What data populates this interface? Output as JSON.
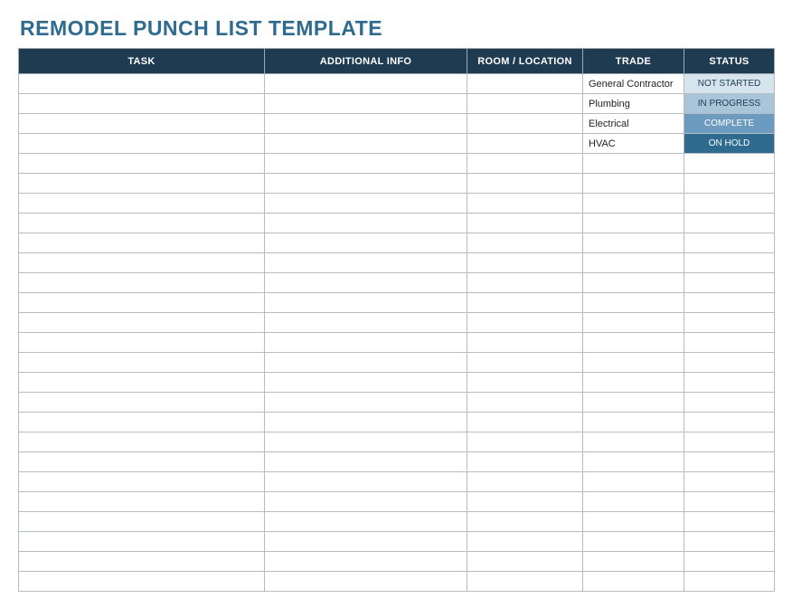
{
  "title": "REMODEL PUNCH LIST TEMPLATE",
  "columns": {
    "task": "TASK",
    "info": "ADDITIONAL INFO",
    "room": "ROOM / LOCATION",
    "trade": "TRADE",
    "status": "STATUS"
  },
  "rows": [
    {
      "task": "",
      "info": "",
      "room": "",
      "trade": "General Contractor",
      "status": "NOT STARTED",
      "status_class": "st-not-started"
    },
    {
      "task": "",
      "info": "",
      "room": "",
      "trade": "Plumbing",
      "status": "IN PROGRESS",
      "status_class": "st-in-progress"
    },
    {
      "task": "",
      "info": "",
      "room": "",
      "trade": "Electrical",
      "status": "COMPLETE",
      "status_class": "st-complete"
    },
    {
      "task": "",
      "info": "",
      "room": "",
      "trade": "HVAC",
      "status": "ON HOLD",
      "status_class": "st-on-hold"
    },
    {
      "task": "",
      "info": "",
      "room": "",
      "trade": "",
      "status": "",
      "status_class": ""
    },
    {
      "task": "",
      "info": "",
      "room": "",
      "trade": "",
      "status": "",
      "status_class": ""
    },
    {
      "task": "",
      "info": "",
      "room": "",
      "trade": "",
      "status": "",
      "status_class": ""
    },
    {
      "task": "",
      "info": "",
      "room": "",
      "trade": "",
      "status": "",
      "status_class": ""
    },
    {
      "task": "",
      "info": "",
      "room": "",
      "trade": "",
      "status": "",
      "status_class": ""
    },
    {
      "task": "",
      "info": "",
      "room": "",
      "trade": "",
      "status": "",
      "status_class": ""
    },
    {
      "task": "",
      "info": "",
      "room": "",
      "trade": "",
      "status": "",
      "status_class": ""
    },
    {
      "task": "",
      "info": "",
      "room": "",
      "trade": "",
      "status": "",
      "status_class": ""
    },
    {
      "task": "",
      "info": "",
      "room": "",
      "trade": "",
      "status": "",
      "status_class": ""
    },
    {
      "task": "",
      "info": "",
      "room": "",
      "trade": "",
      "status": "",
      "status_class": ""
    },
    {
      "task": "",
      "info": "",
      "room": "",
      "trade": "",
      "status": "",
      "status_class": ""
    },
    {
      "task": "",
      "info": "",
      "room": "",
      "trade": "",
      "status": "",
      "status_class": ""
    },
    {
      "task": "",
      "info": "",
      "room": "",
      "trade": "",
      "status": "",
      "status_class": ""
    },
    {
      "task": "",
      "info": "",
      "room": "",
      "trade": "",
      "status": "",
      "status_class": ""
    },
    {
      "task": "",
      "info": "",
      "room": "",
      "trade": "",
      "status": "",
      "status_class": ""
    },
    {
      "task": "",
      "info": "",
      "room": "",
      "trade": "",
      "status": "",
      "status_class": ""
    },
    {
      "task": "",
      "info": "",
      "room": "",
      "trade": "",
      "status": "",
      "status_class": ""
    },
    {
      "task": "",
      "info": "",
      "room": "",
      "trade": "",
      "status": "",
      "status_class": ""
    },
    {
      "task": "",
      "info": "",
      "room": "",
      "trade": "",
      "status": "",
      "status_class": ""
    },
    {
      "task": "",
      "info": "",
      "room": "",
      "trade": "",
      "status": "",
      "status_class": ""
    },
    {
      "task": "",
      "info": "",
      "room": "",
      "trade": "",
      "status": "",
      "status_class": ""
    },
    {
      "task": "",
      "info": "",
      "room": "",
      "trade": "",
      "status": "",
      "status_class": ""
    }
  ]
}
